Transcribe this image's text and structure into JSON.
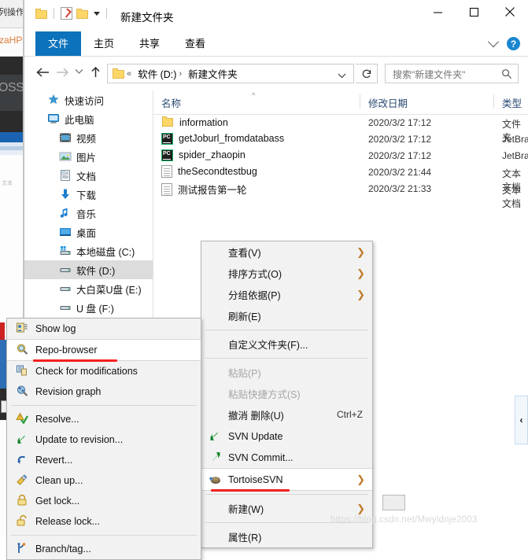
{
  "background": {
    "ide_label_1": "列操作",
    "ide_label_2": "zaHP",
    "console_text": "OSS",
    "small_label": "文本"
  },
  "window": {
    "title": "新建文件夹",
    "quick_access": [
      {
        "name": "folder-icon",
        "label": ""
      },
      {
        "name": "properties-icon",
        "label": ""
      },
      {
        "name": "new-folder-icon",
        "label": ""
      },
      {
        "name": "customize-quick-access-caret",
        "label": ""
      }
    ],
    "controls": {
      "minimize": "−",
      "maximize": "□",
      "close": "✕"
    }
  },
  "ribbon": {
    "tabs": [
      {
        "label": "文件",
        "active": true
      },
      {
        "label": "主页",
        "active": false
      },
      {
        "label": "共享",
        "active": false
      },
      {
        "label": "查看",
        "active": false
      }
    ],
    "expand_icon": "chevron-down-icon",
    "help_icon": "?"
  },
  "addressbar": {
    "back_icon": "arrow-left-icon",
    "forward_icon": "arrow-right-icon",
    "recent_icon": "chevron-down-icon",
    "up_icon": "arrow-up-icon",
    "breadcrumb": {
      "overflow": "«",
      "segments": [
        "软件 (D:)",
        "新建文件夹"
      ],
      "separator": "›"
    },
    "dropdown_icon": "chevron-down-icon",
    "refresh_icon": "refresh-icon",
    "search_placeholder": "搜索\"新建文件夹\"",
    "search_value": "",
    "search_icon": "search-icon"
  },
  "navpane": {
    "items": [
      {
        "label": "快速访问",
        "icon": "star-pin-icon",
        "indent": 0,
        "selected": false
      },
      {
        "label": "此电脑",
        "icon": "computer-icon",
        "indent": 0,
        "selected": false
      },
      {
        "label": "视频",
        "icon": "video-icon",
        "indent": 1,
        "selected": false
      },
      {
        "label": "图片",
        "icon": "picture-icon",
        "indent": 1,
        "selected": false
      },
      {
        "label": "文档",
        "icon": "document-icon",
        "indent": 1,
        "selected": false
      },
      {
        "label": "下载",
        "icon": "download-icon",
        "indent": 1,
        "selected": false
      },
      {
        "label": "音乐",
        "icon": "music-icon",
        "indent": 1,
        "selected": false
      },
      {
        "label": "桌面",
        "icon": "desktop-icon",
        "indent": 1,
        "selected": false
      },
      {
        "label": "本地磁盘 (C:)",
        "icon": "windows-drive-icon",
        "indent": 1,
        "selected": false
      },
      {
        "label": "软件 (D:)",
        "icon": "drive-icon",
        "indent": 1,
        "selected": true
      },
      {
        "label": "大白菜U盘 (E:)",
        "icon": "drive-icon",
        "indent": 1,
        "selected": false
      },
      {
        "label": "U 盘 (F:)",
        "icon": "drive-icon",
        "indent": 1,
        "selected": false
      }
    ]
  },
  "filelist": {
    "columns": [
      {
        "label": "名称",
        "key": "name"
      },
      {
        "label": "修改日期",
        "key": "date"
      },
      {
        "label": "类型",
        "key": "type"
      }
    ],
    "sort_indicator": "^",
    "rows": [
      {
        "name": "information",
        "date": "2020/3/2 17:12",
        "type": "文件夹",
        "icon": "folder-icon"
      },
      {
        "name": "getJoburl_fromdatabass",
        "date": "2020/3/2 17:12",
        "type": "JetBrai",
        "icon": "pycharm-icon"
      },
      {
        "name": "spider_zhaopin",
        "date": "2020/3/2 17:12",
        "type": "JetBrai",
        "icon": "pycharm-icon"
      },
      {
        "name": "theSecondtestbug",
        "date": "2020/3/2 21:44",
        "type": "文本文档",
        "icon": "text-file-icon"
      },
      {
        "name": "测试报告第一轮",
        "date": "2020/3/2 21:33",
        "type": "文本文档",
        "icon": "text-file-icon"
      }
    ]
  },
  "right_pane": {
    "collapse_icon": "‹"
  },
  "context_menu": {
    "items": [
      {
        "label": "查看(V)",
        "submenu": true,
        "disabled": false,
        "shortcut": "",
        "icon": "",
        "highlight": false,
        "sep_after": false
      },
      {
        "label": "排序方式(O)",
        "submenu": true,
        "disabled": false,
        "shortcut": "",
        "icon": "",
        "highlight": false,
        "sep_after": false
      },
      {
        "label": "分组依据(P)",
        "submenu": true,
        "disabled": false,
        "shortcut": "",
        "icon": "",
        "highlight": false,
        "sep_after": false
      },
      {
        "label": "刷新(E)",
        "submenu": false,
        "disabled": false,
        "shortcut": "",
        "icon": "",
        "highlight": false,
        "sep_after": true
      },
      {
        "label": "自定义文件夹(F)...",
        "submenu": false,
        "disabled": false,
        "shortcut": "",
        "icon": "",
        "highlight": false,
        "sep_after": true
      },
      {
        "label": "粘贴(P)",
        "submenu": false,
        "disabled": true,
        "shortcut": "",
        "icon": "",
        "highlight": false,
        "sep_after": false
      },
      {
        "label": "粘贴快捷方式(S)",
        "submenu": false,
        "disabled": true,
        "shortcut": "",
        "icon": "",
        "highlight": false,
        "sep_after": false
      },
      {
        "label": "撤消 删除(U)",
        "submenu": false,
        "disabled": false,
        "shortcut": "Ctrl+Z",
        "icon": "",
        "highlight": false,
        "sep_after": false
      },
      {
        "label": "SVN Update",
        "submenu": false,
        "disabled": false,
        "shortcut": "",
        "icon": "svn-update-icon",
        "highlight": false,
        "sep_after": false
      },
      {
        "label": "SVN Commit...",
        "submenu": false,
        "disabled": false,
        "shortcut": "",
        "icon": "svn-commit-icon",
        "highlight": false,
        "sep_after": false
      },
      {
        "label": "TortoiseSVN",
        "submenu": true,
        "disabled": false,
        "shortcut": "",
        "icon": "tortoise-icon",
        "highlight": true,
        "sep_after": true
      },
      {
        "label": "新建(W)",
        "submenu": true,
        "disabled": false,
        "shortcut": "",
        "icon": "",
        "highlight": false,
        "sep_after": true
      },
      {
        "label": "属性(R)",
        "submenu": false,
        "disabled": false,
        "shortcut": "",
        "icon": "",
        "highlight": false,
        "sep_after": false
      }
    ]
  },
  "tortoise_submenu": {
    "items": [
      {
        "label": "Show log",
        "icon": "show-log-icon",
        "highlight": false,
        "sep_after": false
      },
      {
        "label": "Repo-browser",
        "icon": "repo-browser-icon",
        "highlight": true,
        "sep_after": false
      },
      {
        "label": "Check for modifications",
        "icon": "check-modifications-icon",
        "highlight": false,
        "sep_after": false
      },
      {
        "label": "Revision graph",
        "icon": "revision-graph-icon",
        "highlight": false,
        "sep_after": true
      },
      {
        "label": "Resolve...",
        "icon": "resolve-icon",
        "highlight": false,
        "sep_after": false
      },
      {
        "label": "Update to revision...",
        "icon": "update-revision-icon",
        "highlight": false,
        "sep_after": false
      },
      {
        "label": "Revert...",
        "icon": "revert-icon",
        "highlight": false,
        "sep_after": false
      },
      {
        "label": "Clean up...",
        "icon": "cleanup-icon",
        "highlight": false,
        "sep_after": false
      },
      {
        "label": "Get lock...",
        "icon": "get-lock-icon",
        "highlight": false,
        "sep_after": false
      },
      {
        "label": "Release lock...",
        "icon": "release-lock-icon",
        "highlight": false,
        "sep_after": true
      },
      {
        "label": "Branch/tag...",
        "icon": "branch-tag-icon",
        "highlight": false,
        "sep_after": false
      }
    ]
  },
  "watermark": {
    "text": "https://blog.csdn.net/Mwyldnje2003"
  },
  "colors": {
    "accent": "#0b72bb",
    "highlight_red": "#f32020",
    "selection_grey": "#dcdcdc",
    "column_header": "#2a4a74"
  }
}
